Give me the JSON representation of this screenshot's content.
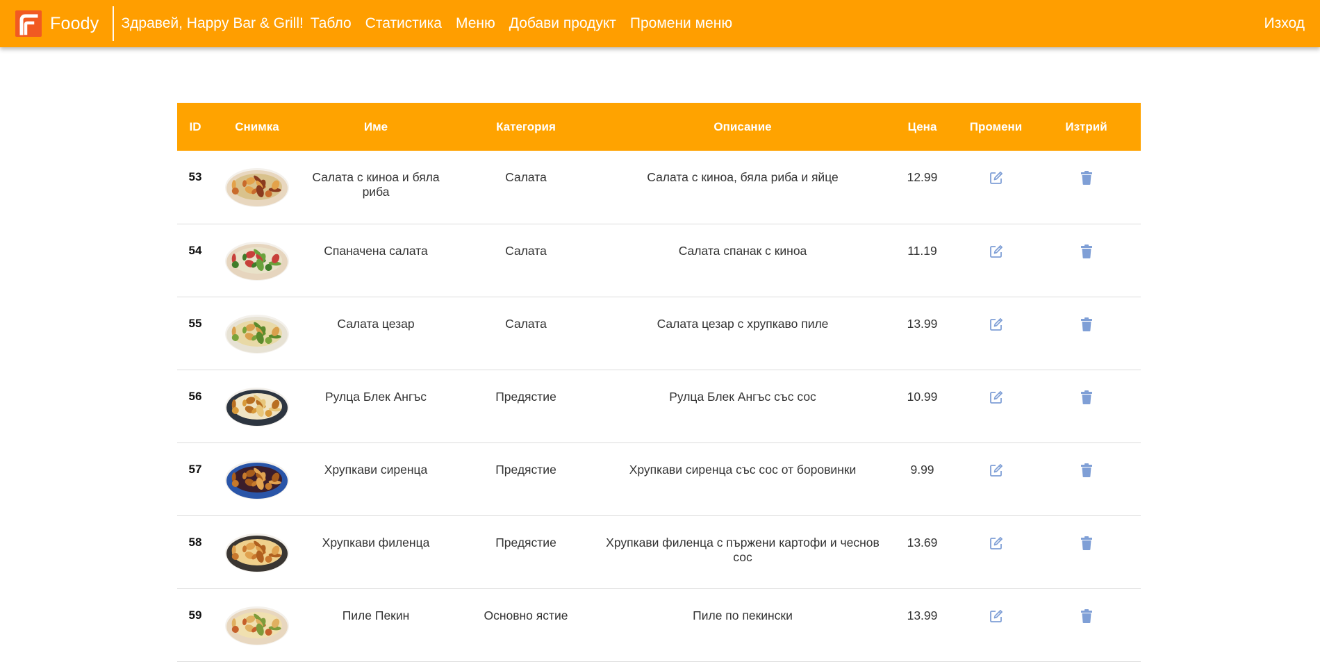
{
  "navbar": {
    "brand": "Foody",
    "greeting": "Здравей, Happy Bar & Grill!",
    "links": [
      "Табло",
      "Статистика",
      "Меню",
      "Добави продукт",
      "Промени меню"
    ],
    "logout": "Изход",
    "colors": {
      "bar": "#ff9e00",
      "logo": "#f15a22"
    },
    "logo_icon": "foody-logo-icon"
  },
  "table": {
    "headers": {
      "id": "ID",
      "image": "Снимка",
      "name": "Име",
      "category": "Категория",
      "description": "Описание",
      "price": "Цена",
      "edit": "Промени",
      "delete": "Изтрий"
    },
    "header_color": "#ffa300",
    "action_icon_color": "#7f9fd6",
    "edit_icon": "edit-icon",
    "delete_icon": "trash-icon",
    "rows": [
      {
        "id": "53",
        "name": "Салата с киноа и бяла риба",
        "category": "Салата",
        "description": "Салата с киноа, бяла риба и яйце",
        "price": "12.99",
        "image_kind": "salad-fish-photo"
      },
      {
        "id": "54",
        "name": "Спаначена салата",
        "category": "Салата",
        "description": "Салата спанак с киноа",
        "price": "11.19",
        "image_kind": "spinach-salad-photo"
      },
      {
        "id": "55",
        "name": "Салата цезар",
        "category": "Салата",
        "description": "Салата цезар с хрупкаво пиле",
        "price": "13.99",
        "image_kind": "caesar-salad-photo"
      },
      {
        "id": "56",
        "name": "Рулца Блек Ангъс",
        "category": "Предястие",
        "description": "Рулца Блек Ангъс със сос",
        "price": "10.99",
        "image_kind": "rolls-photo"
      },
      {
        "id": "57",
        "name": "Хрупкави сиренца",
        "category": "Предястие",
        "description": "Хрупкави сиренца със сос от боровинки",
        "price": "9.99",
        "image_kind": "cheese-bites-photo"
      },
      {
        "id": "58",
        "name": "Хрупкави филенца",
        "category": "Предястие",
        "description": "Хрупкави филенца с пържени картофи и чеснов сос",
        "price": "13.69",
        "image_kind": "chicken-tenders-photo"
      },
      {
        "id": "59",
        "name": "Пиле Пекин",
        "category": "Основно ястие",
        "description": "Пиле по пекински",
        "price": "13.99",
        "image_kind": "peking-chicken-photo"
      }
    ]
  }
}
